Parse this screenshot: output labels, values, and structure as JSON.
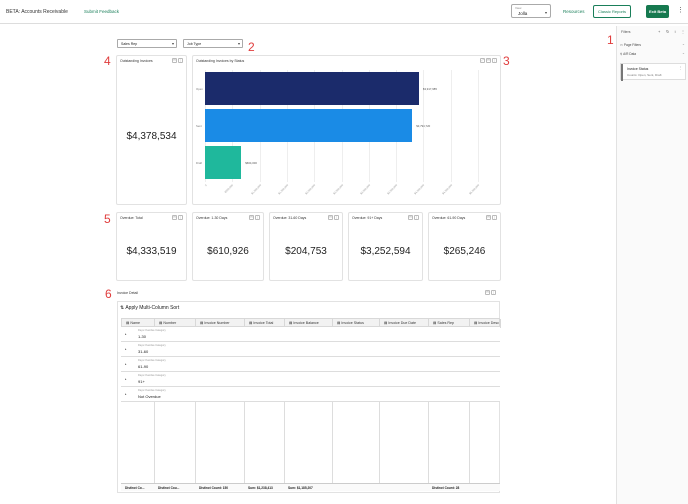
{
  "header": {
    "title": "BETA: Accounts Receivable",
    "feedback": "Submit Feedback",
    "view_label": "View",
    "view_value": "Jolla",
    "resources": "Resources",
    "classic_reports": "Classic Reports",
    "exit_beta": "Exit Beta"
  },
  "filters": {
    "title": "Filters",
    "page_filters": "Page Filters",
    "a_r_data": "A/R Data",
    "card_title": "Invoice Status",
    "card_sub": "Counts: Open, Sent, Draft"
  },
  "dropdowns": {
    "sales_rep": "Sales Rep",
    "job_type": "Job Type"
  },
  "annotations": [
    "1",
    "2",
    "3",
    "4",
    "5",
    "6"
  ],
  "outstanding": {
    "title": "Outstanding Invoices",
    "value": "$4,378,534"
  },
  "status_chart": {
    "title": "Outstanding Invoices by Status"
  },
  "chart_data": {
    "type": "bar",
    "orientation": "horizontal",
    "title": "Outstanding Invoices by Status",
    "categories": [
      "Open",
      "Sent",
      "Draft"
    ],
    "values": [
      3917985,
      3794720,
      664000
    ],
    "value_labels": [
      "$3,917,985",
      "$3,794,720",
      "$664,000"
    ],
    "colors": [
      "#1b2b6b",
      "#1a8be6",
      "#1fb89c"
    ],
    "x_ticks": [
      "0",
      "$500,000",
      "$1,000,000",
      "$1,500,000",
      "$2,000,000",
      "$2,500,000",
      "$3,000,000",
      "$3,500,000",
      "$4,000,000",
      "$4,500,000",
      "$5,000,000"
    ],
    "xlim": [
      0,
      5000000
    ],
    "grid": true
  },
  "overdue": [
    {
      "title": "Overdue: Total",
      "value": "$4,333,519"
    },
    {
      "title": "Overdue: 1-30 Days",
      "value": "$610,926"
    },
    {
      "title": "Overdue: 31-60 Days",
      "value": "$204,753"
    },
    {
      "title": "Overdue: 91+ Days",
      "value": "$3,252,594"
    },
    {
      "title": "Overdue: 61-90 Days",
      "value": "$265,246"
    }
  ],
  "invoice_detail": {
    "title": "Invoice Detail",
    "sort_button": "Apply Multi-Column Sort",
    "columns": [
      "Name",
      "Number",
      "Invoice Number",
      "Invoice Total",
      "Invoice Balance",
      "Invoice Status",
      "Invoice Due Date",
      "Sales Rep",
      "Invoice Desc"
    ],
    "group_caption": "Days Overdue Category",
    "groups": [
      "1-30",
      "31-60",
      "61-90",
      "91+",
      "Not Overdue"
    ],
    "footer": [
      "Distinct Co...",
      "Distinct Cou...",
      "Distinct Count: 150",
      "Sum: $1,238,413",
      "Sum: $1,185,207",
      "",
      "",
      "Distinct Count: 28",
      ""
    ]
  }
}
